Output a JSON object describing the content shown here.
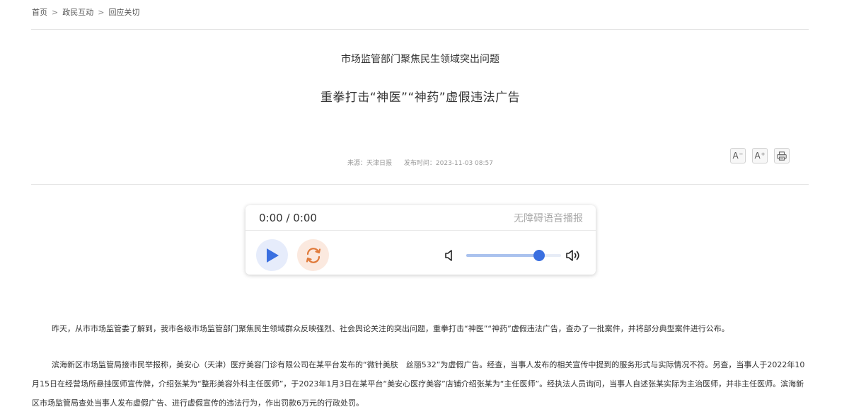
{
  "breadcrumb": {
    "items": [
      "首页",
      "政民互动",
      "回应关切"
    ],
    "separator": ">"
  },
  "article": {
    "subtitle": "市场监管部门聚焦民生领域突出问题",
    "title": "重拳打击“神医”“神药”虚假违法广告",
    "source": "来源：天津日报",
    "publish_time": "发布时间：2023-11-03 08:57",
    "paragraphs": [
      "昨天，从市市场监管委了解到，我市各级市场监管部门聚焦民生领域群众反映强烈、社会舆论关注的突出问题，重拳打击“神医”“神药”虚假违法广告，查办了一批案件，并将部分典型案件进行公布。",
      "滨海新区市场监管局接市民举报称，美安心（天津）医疗美容门诊有限公司在某平台发布的“微针美肤　丝丽532”为虚假广告。经查，当事人发布的相关宣传中提到的服务形式与实际情况不符。另查，当事人于2022年10月15日在经营场所悬挂医师宣传牌，介绍张某为“整形美容外科主任医师”，于2023年1月3日在某平台“美安心医疗美容”店铺介绍张某为“主任医师”。经执法人员询问，当事人自述张某实际为主治医师，并非主任医师。滨海新区市场监管局查处当事人发布虚假广告、进行虚假宣传的违法行为，作出罚款6万元的行政处罚。"
    ]
  },
  "tools": {
    "decrease_font": "A",
    "increase_font": "A",
    "decrease_sign": "−",
    "increase_sign": "+",
    "print_icon": "print-icon"
  },
  "player": {
    "time": "0:00 / 0:00",
    "label": "无障碍语音播报",
    "volume": 0.77,
    "play_icon": "play-icon",
    "loop_icon": "loop-icon",
    "accent_color": "#3a6fe0",
    "loop_color": "#e07a3a"
  }
}
